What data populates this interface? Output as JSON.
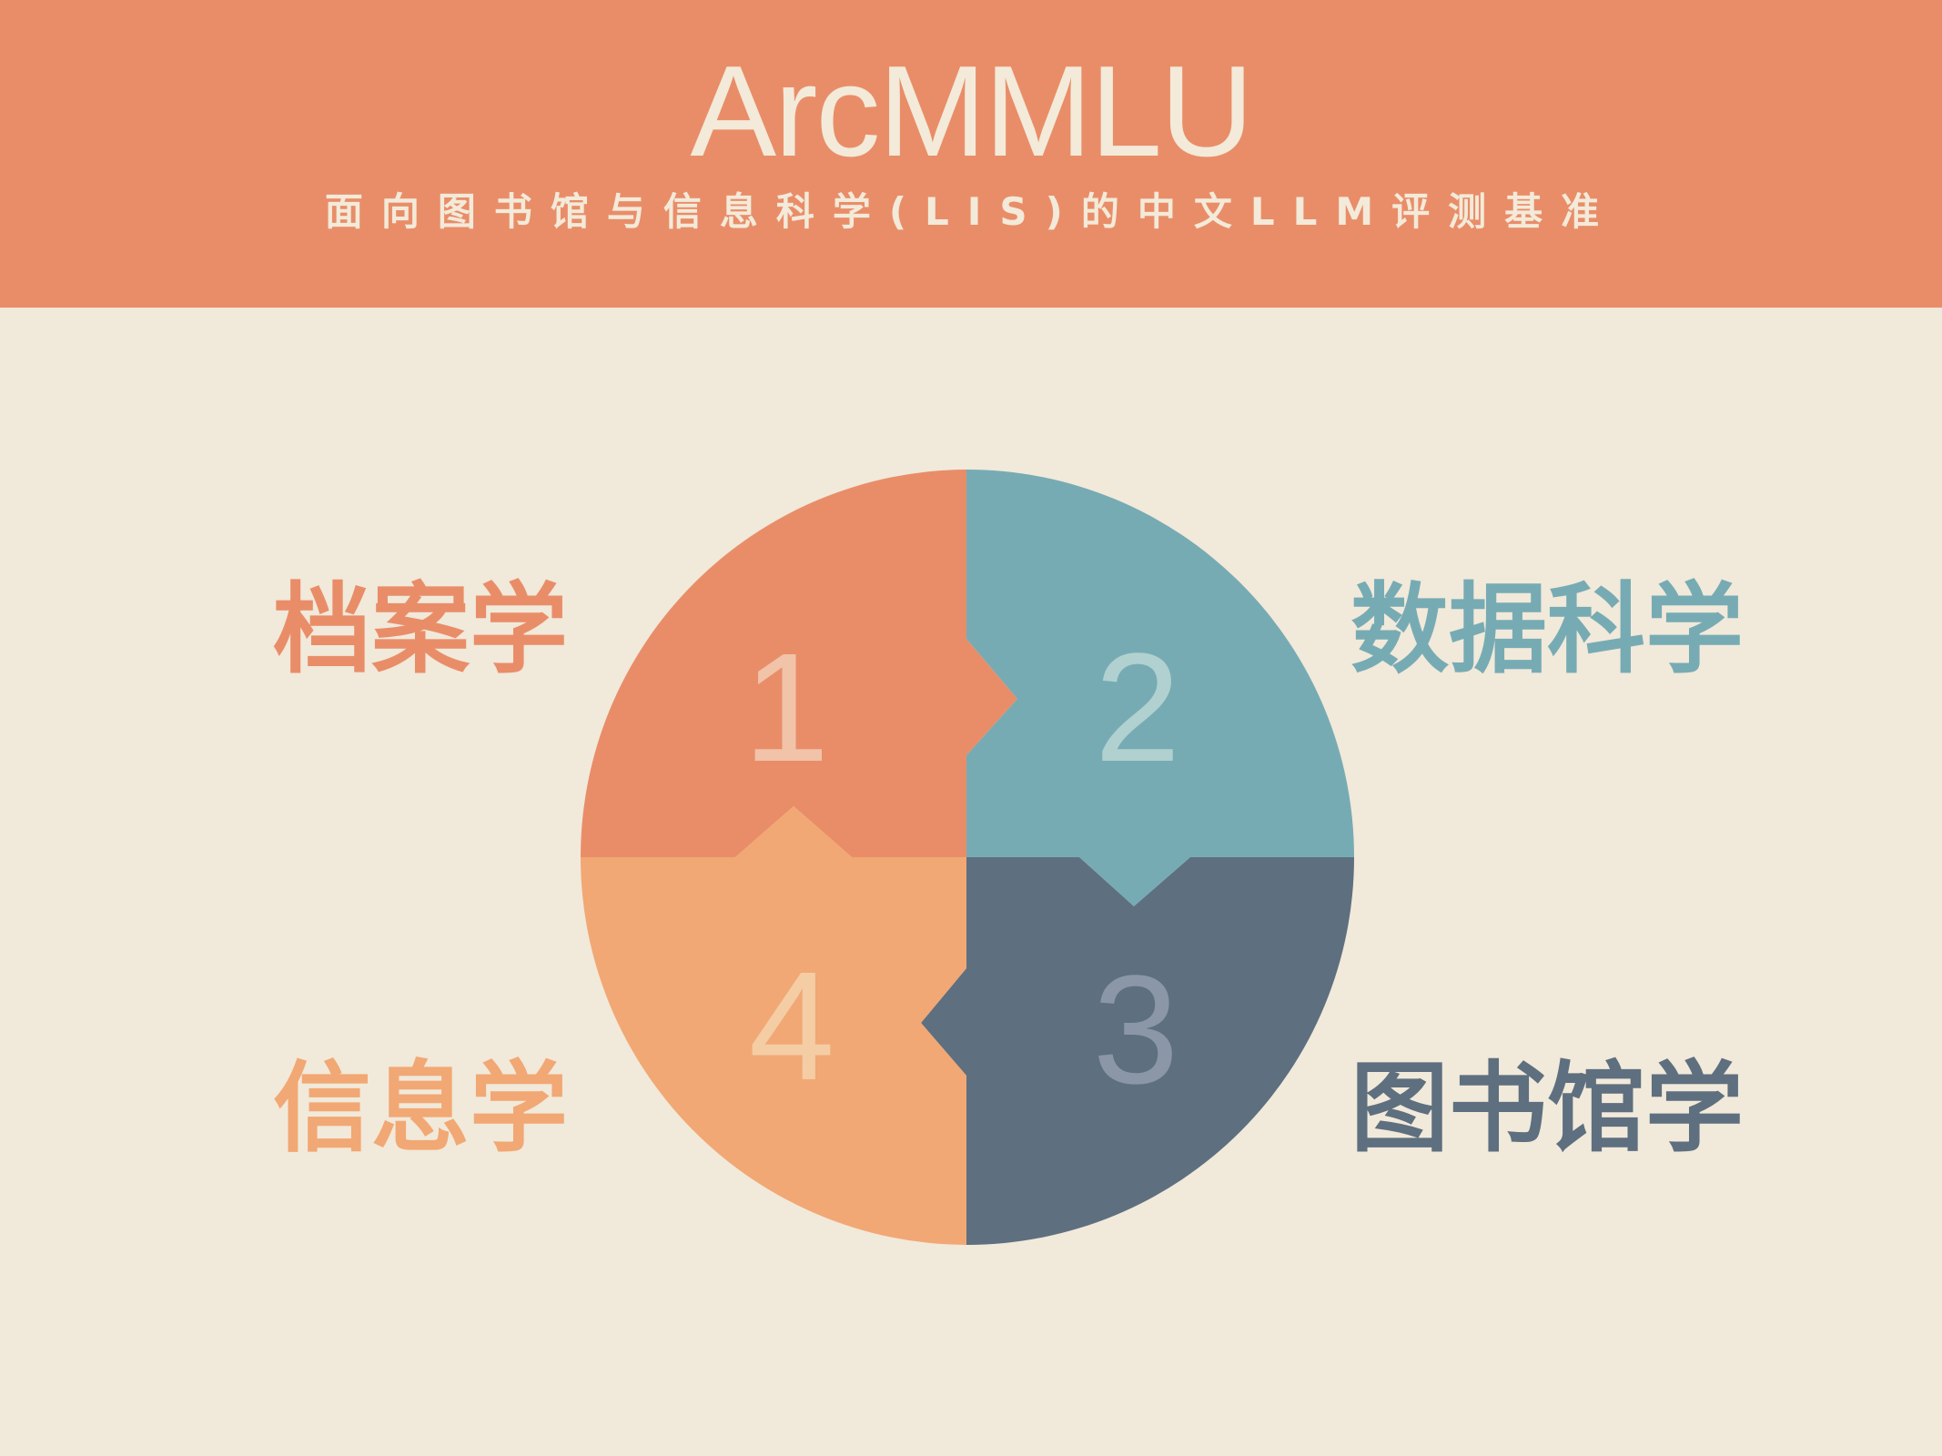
{
  "header": {
    "title": "ArcMMLU",
    "subtitle": "面向图书馆与信息科学(LIS)的中文LLM评测基准"
  },
  "quadrants": [
    {
      "number": "1",
      "label": "档案学",
      "color": "#E98D69",
      "number_color": "#F1C3A9"
    },
    {
      "number": "2",
      "label": "数据科学",
      "color": "#77ABB4",
      "number_color": "#B0D1D0"
    },
    {
      "number": "3",
      "label": "图书馆学",
      "color": "#5E6F7F",
      "label_color": "#5E6F7F",
      "number_color": "#8B97A6"
    },
    {
      "number": "4",
      "label": "信息学",
      "color": "#F1A874",
      "number_color": "#F4CDA5"
    }
  ],
  "background_color": "#F1E9DA"
}
